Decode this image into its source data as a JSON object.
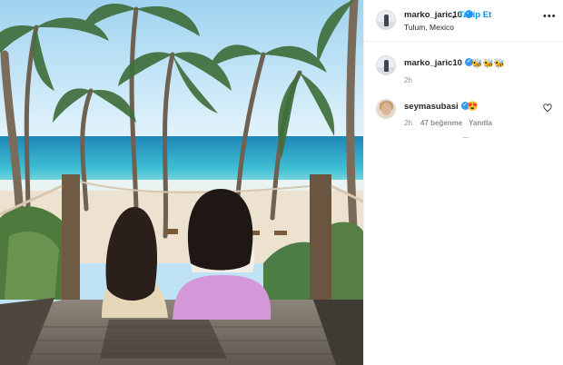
{
  "post": {
    "username": "marko_jaric10",
    "follow_label": "Takip Et",
    "separator": "•",
    "location": "Tulum, Mexico",
    "more_label": "•••"
  },
  "caption": {
    "username": "marko_jaric10",
    "text": "🐝🐝🐝",
    "time": "2h"
  },
  "comments": [
    {
      "username": "seymasubasi",
      "text": "😍",
      "time": "2h",
      "likes": "47 beğenme",
      "reply_label": "Yanıtla"
    }
  ],
  "icons": {
    "verified": "verified-badge-icon",
    "heart": "heart-outline-icon",
    "more": "more-options-icon"
  },
  "colors": {
    "follow": "#0095f6",
    "verified": "#3897f0",
    "meta": "#8e8e8e"
  }
}
